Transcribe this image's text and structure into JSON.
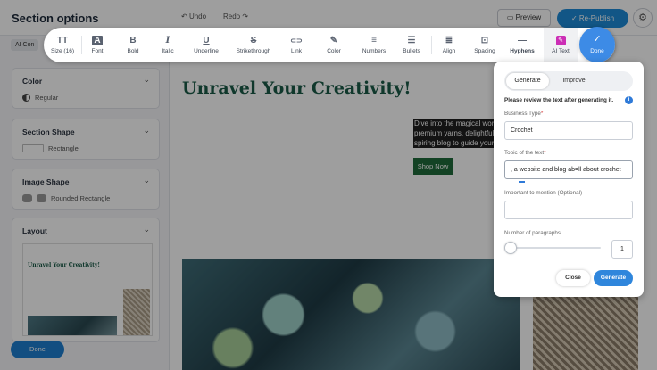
{
  "header": {
    "title": "Section options",
    "undo": "Undo",
    "redo": "Redo",
    "preview": "Preview",
    "republish": "Re-Publish"
  },
  "sidebar": {
    "ai_tab": "AI Con",
    "color": {
      "title": "Color",
      "value": "Regular"
    },
    "section_shape": {
      "title": "Section Shape",
      "value": "Rectangle"
    },
    "image_shape": {
      "title": "Image Shape",
      "value": "Rounded Rectangle"
    },
    "layout": {
      "title": "Layout",
      "thumb_title": "Unravel Your Creativity!"
    },
    "done": "Done"
  },
  "canvas": {
    "title": "Unravel Your Creativity!",
    "text_lines": [
      "Dive into the magical worl",
      "premium yarns, delightful",
      "spiring blog to guide your"
    ],
    "shop_button": "Shop Now"
  },
  "toolbar": {
    "items": [
      {
        "label": "Size (16)",
        "icon": "text-size-icon",
        "glyph": "TT"
      },
      {
        "label": "Font",
        "icon": "font-icon",
        "glyph": "A"
      },
      {
        "label": "Bold",
        "icon": "bold-icon",
        "glyph": "B"
      },
      {
        "label": "Italic",
        "icon": "italic-icon",
        "glyph": "I"
      },
      {
        "label": "Underline",
        "icon": "underline-icon",
        "glyph": "U"
      },
      {
        "label": "Strikethrough",
        "icon": "strikethrough-icon",
        "glyph": "S"
      },
      {
        "label": "Link",
        "icon": "link-icon",
        "glyph": "⊂⊃"
      },
      {
        "label": "Color",
        "icon": "pen-icon",
        "glyph": "✎"
      },
      {
        "label": "Numbers",
        "icon": "numbered-list-icon",
        "glyph": "≡"
      },
      {
        "label": "Bullets",
        "icon": "bullet-list-icon",
        "glyph": "☰"
      },
      {
        "label": "Align",
        "icon": "align-icon",
        "glyph": "≣"
      },
      {
        "label": "Spacing",
        "icon": "spacing-icon",
        "glyph": "⊡"
      },
      {
        "label": "Hyphens",
        "icon": "hyphens-icon",
        "glyph": "—"
      },
      {
        "label": "AI Text",
        "icon": "ai-text-icon",
        "glyph": "✎"
      }
    ],
    "done": "Done"
  },
  "ai_panel": {
    "tabs": [
      "Generate",
      "Improve"
    ],
    "active_tab": "Generate",
    "note": "Please review the text after generating it.",
    "business_type": {
      "label": "Business Type",
      "value": "Crochet"
    },
    "topic": {
      "label": "Topic of the text",
      "value": ", a website and blog ab=ll about crochet"
    },
    "important": {
      "label": "Important to mention (Optional)",
      "value": ""
    },
    "paragraphs": {
      "label": "Number of paragraphs",
      "value": "1",
      "slider_level": 0
    },
    "close": "Close",
    "generate": "Generate"
  },
  "colors": {
    "accent": "#2f86dc",
    "title_green": "#1a5b48",
    "shop_button": "#1f6b3a",
    "ai_icon": "#cc2eb5"
  }
}
